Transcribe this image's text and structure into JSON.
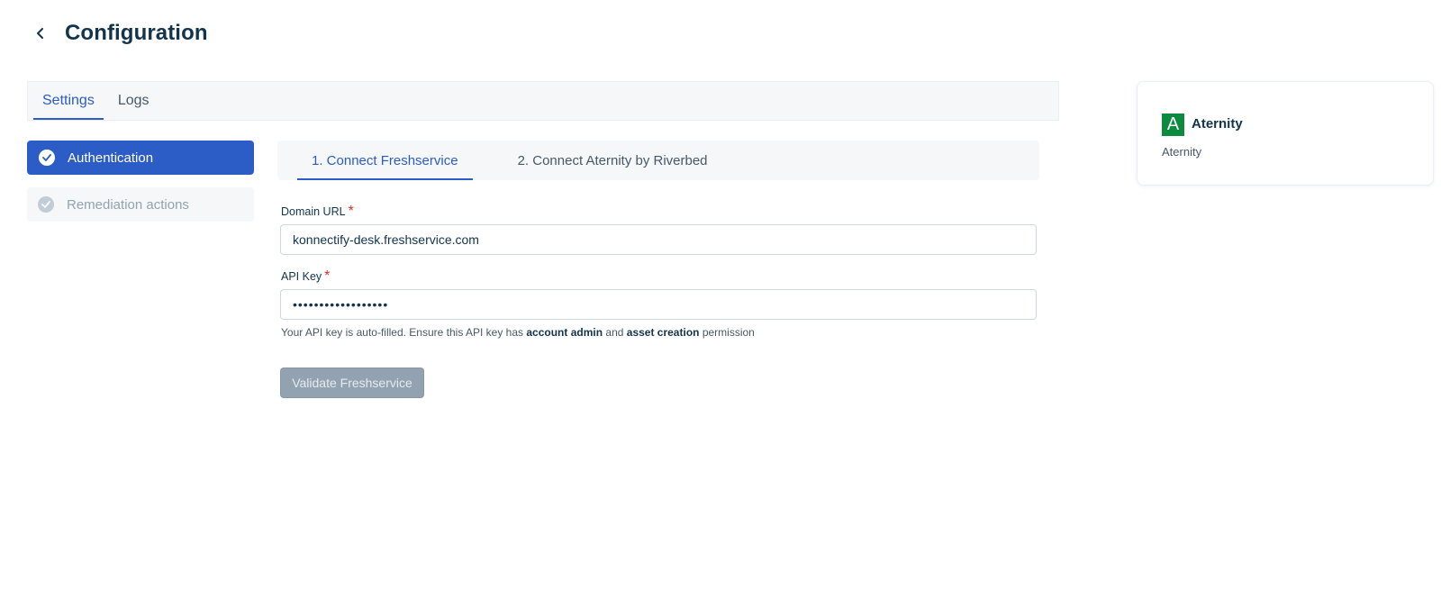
{
  "header": {
    "title": "Configuration",
    "back_icon": "chevron-left-icon"
  },
  "top_tabs": [
    {
      "label": "Settings",
      "active": true
    },
    {
      "label": "Logs",
      "active": false
    }
  ],
  "left_nav": {
    "items": [
      {
        "label": "Authentication",
        "active": true,
        "icon": "check-circle-icon"
      },
      {
        "label": "Remediation actions",
        "active": false,
        "icon": "check-circle-icon"
      }
    ]
  },
  "steps": [
    {
      "label": "1. Connect Freshservice",
      "active": true
    },
    {
      "label": "2. Connect Aternity by Riverbed",
      "active": false
    }
  ],
  "form": {
    "domain_label": "Domain URL",
    "domain_value": "konnectify-desk.freshservice.com",
    "api_label": "API Key",
    "api_value": "••••••••••••••••••",
    "required_mark": "*",
    "help": {
      "part1": "Your API key is auto-filled. Ensure this API key has ",
      "bold1": "account admin",
      "part2": " and ",
      "bold2": "asset creation",
      "part3": " permission"
    },
    "validate_label": "Validate Freshservice"
  },
  "app_card": {
    "logo_letter": "A",
    "name": "Aternity",
    "subtitle": "Aternity"
  },
  "colors": {
    "accent": "#2c5cc5",
    "text": "#12344d",
    "muted": "#92a2b1",
    "logo_green": "#0c8b3e",
    "required": "#d72d30"
  }
}
